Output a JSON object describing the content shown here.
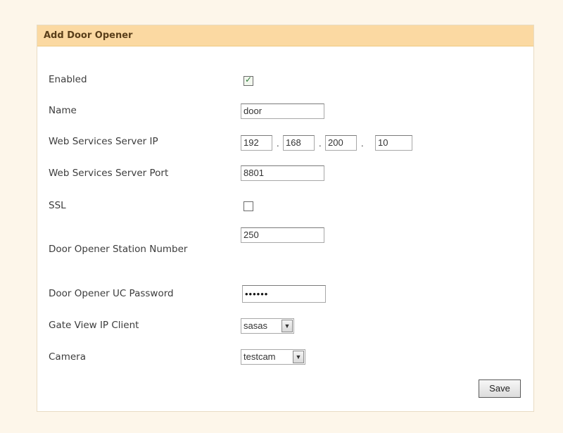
{
  "panel": {
    "title": "Add Door Opener"
  },
  "fields": {
    "enabled": {
      "label": "Enabled",
      "checked": true
    },
    "name": {
      "label": "Name",
      "value": "door"
    },
    "ws_ip": {
      "label": "Web Services Server IP",
      "octets": [
        "192",
        "168",
        "200",
        "10"
      ]
    },
    "ws_port": {
      "label": "Web Services Server Port",
      "value": "8801"
    },
    "ssl": {
      "label": "SSL",
      "checked": false
    },
    "station": {
      "label": "Door Opener Station Number",
      "value": "250"
    },
    "uc_password": {
      "label": "Door Opener UC Password",
      "value": "••••••"
    },
    "gate_view": {
      "label": "Gate View IP Client",
      "value": "sasas"
    },
    "camera": {
      "label": "Camera",
      "value": "testcam"
    }
  },
  "actions": {
    "save_label": "Save"
  },
  "icons": {
    "check": "checkmark-icon",
    "dropdown": "chevron-down-icon"
  }
}
